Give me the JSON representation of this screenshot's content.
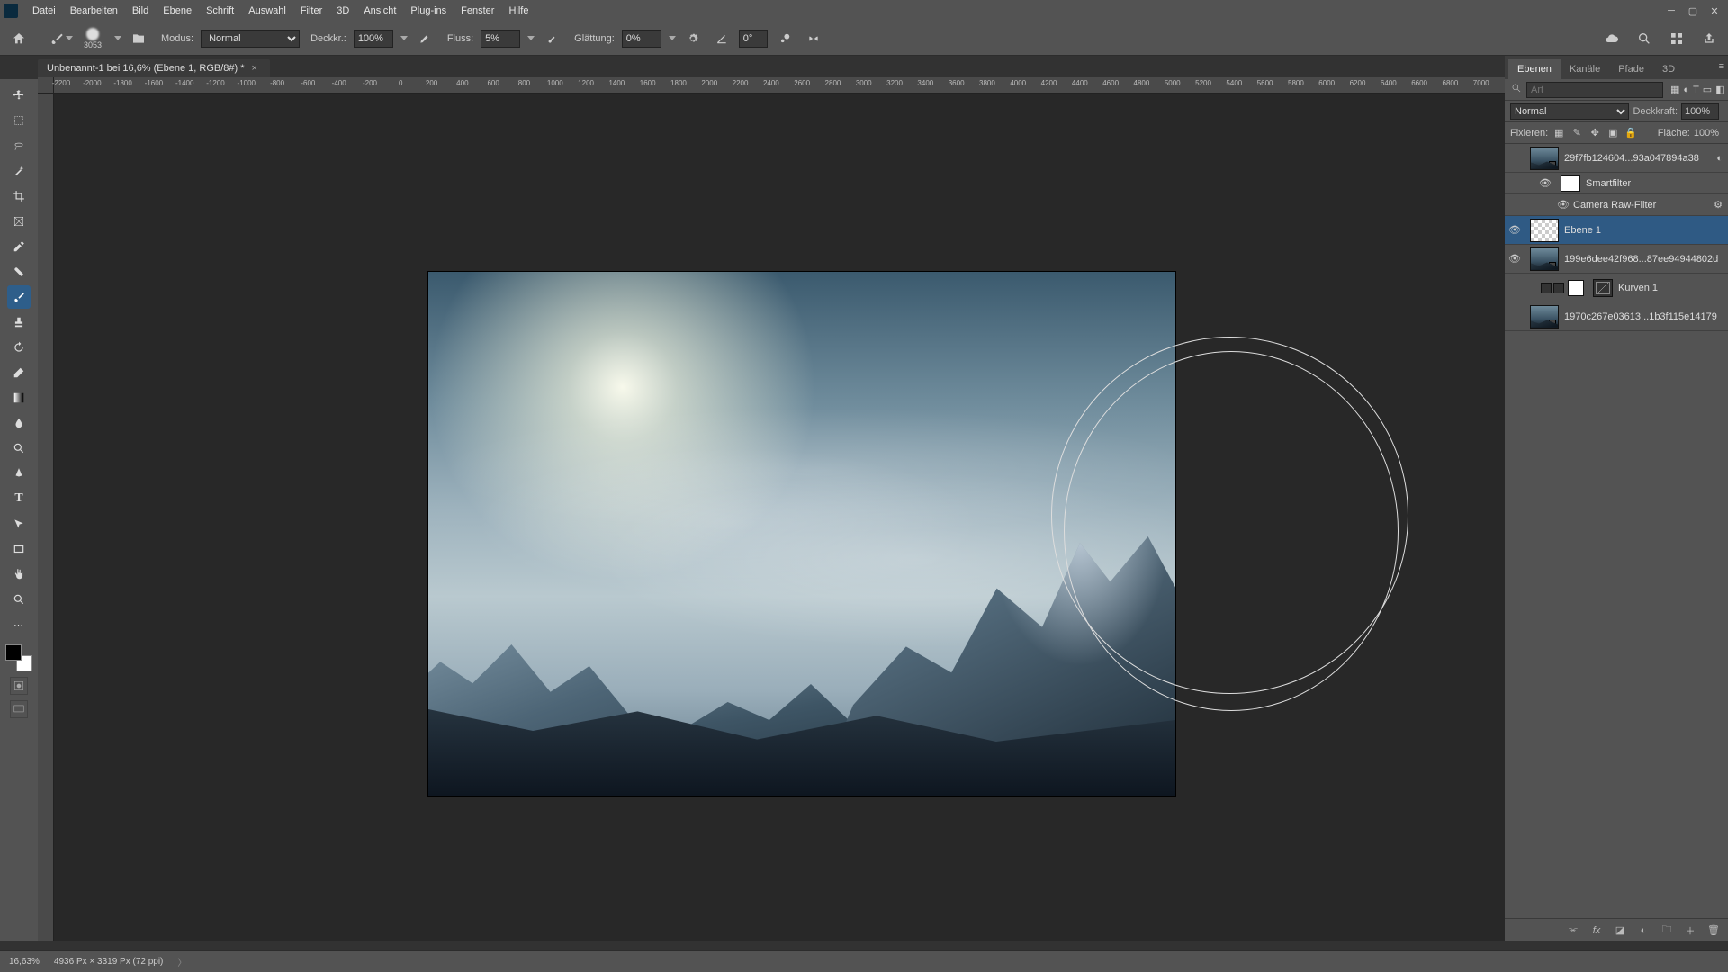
{
  "menu": {
    "items": [
      "Datei",
      "Bearbeiten",
      "Bild",
      "Ebene",
      "Schrift",
      "Auswahl",
      "Filter",
      "3D",
      "Ansicht",
      "Plug-ins",
      "Fenster",
      "Hilfe"
    ]
  },
  "options": {
    "brush_size": "3053",
    "mode_label": "Modus:",
    "mode_value": "Normal",
    "opacity_label": "Deckkr.:",
    "opacity_value": "100%",
    "flow_label": "Fluss:",
    "flow_value": "5%",
    "smoothing_label": "Glättung:",
    "smoothing_value": "0%",
    "angle_value": "0°"
  },
  "document": {
    "tab_title": "Unbenannt-1 bei 16,6% (Ebene 1, RGB/8#) *"
  },
  "ruler_ticks": [
    "-2200",
    "-2000",
    "-1800",
    "-1600",
    "-1400",
    "-1200",
    "-1000",
    "-800",
    "-600",
    "-400",
    "-200",
    "0",
    "200",
    "400",
    "600",
    "800",
    "1000",
    "1200",
    "1400",
    "1600",
    "1800",
    "2000",
    "2200",
    "2400",
    "2600",
    "2800",
    "3000",
    "3200",
    "3400",
    "3600",
    "3800",
    "4000",
    "4200",
    "4400",
    "4600",
    "4800",
    "5000",
    "5200",
    "5400",
    "5600",
    "5800",
    "6000",
    "6200",
    "6400",
    "6600",
    "6800",
    "7000"
  ],
  "panels": {
    "tabs": [
      "Ebenen",
      "Kanäle",
      "Pfade",
      "3D"
    ],
    "filter_placeholder": "Art",
    "blend_mode": "Normal",
    "opacity_label": "Deckkraft:",
    "opacity_value": "100%",
    "lock_label": "Fixieren:",
    "fill_label": "Fläche:",
    "fill_value": "100%"
  },
  "layers": [
    {
      "name": "29f7fb124604...93a047894a38",
      "thumb": "img",
      "visible": false,
      "smart": true
    },
    {
      "name": "Smartfilter",
      "thumb": "white",
      "sub": true
    },
    {
      "name": "Camera Raw-Filter",
      "sub": true,
      "filterentry": true
    },
    {
      "name": "Ebene 1",
      "thumb": "checker",
      "visible": true,
      "selected": true
    },
    {
      "name": "199e6dee42f968...87ee94944802d",
      "thumb": "img",
      "visible": true,
      "smart": true
    },
    {
      "name": "Kurven 1",
      "thumb": "curve",
      "adjustment": true
    },
    {
      "name": "1970c267e03613...1b3f115e14179",
      "thumb": "img",
      "smart": true
    }
  ],
  "status": {
    "zoom": "16,63%",
    "doc_info": "4936 Px × 3319 Px (72 ppi)"
  }
}
